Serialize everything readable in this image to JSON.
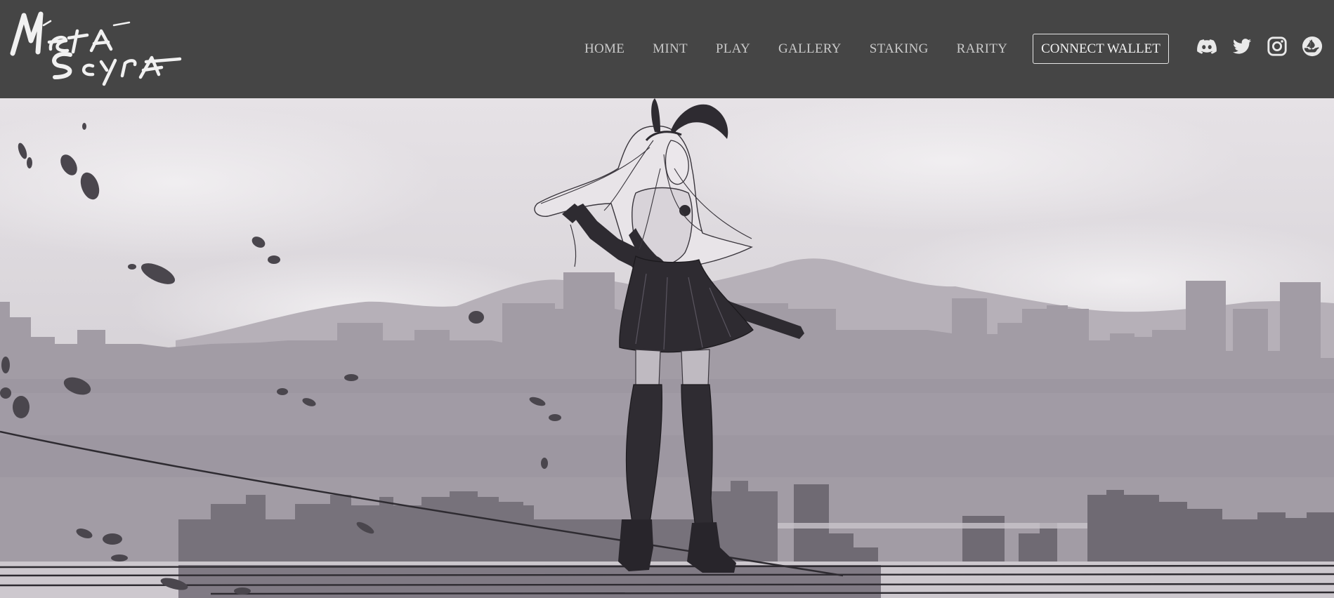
{
  "logo": {
    "line1": "Meta",
    "line2": "Scyra"
  },
  "nav": {
    "items": [
      {
        "label": "HOME"
      },
      {
        "label": "MINT"
      },
      {
        "label": "PLAY"
      },
      {
        "label": "GALLERY"
      },
      {
        "label": "STAKING"
      },
      {
        "label": "RARITY"
      }
    ]
  },
  "wallet": {
    "label": "CONNECT WALLET"
  },
  "socials": [
    {
      "icon": "discord-icon"
    },
    {
      "icon": "twitter-icon"
    },
    {
      "icon": "instagram-icon"
    },
    {
      "icon": "opensea-icon"
    }
  ],
  "colors": {
    "header_bg": "#454545",
    "nav_text": "#c9c9c9",
    "button_border": "#e6e6e6",
    "sky": "#dcd8dc",
    "far_city": "#a09aa3",
    "near_city": "#6f6a73",
    "figure": "#2e2b31"
  }
}
